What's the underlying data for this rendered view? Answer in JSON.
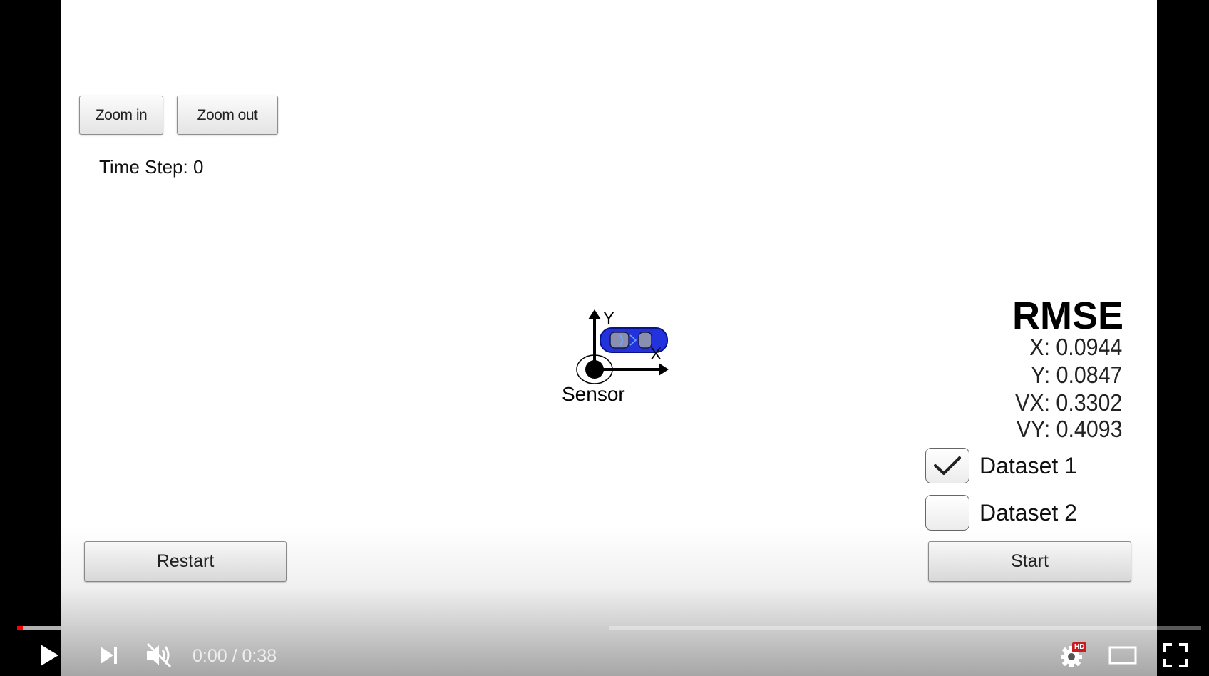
{
  "simulator": {
    "zoom_in_label": "Zoom in",
    "zoom_out_label": "Zoom out",
    "time_step_label": "Time Step:",
    "time_step_value": "0",
    "sensor_label": "Sensor",
    "axis_x_label": "X",
    "axis_y_label": "Y",
    "restart_label": "Restart",
    "start_label": "Start",
    "rmse": {
      "title": "RMSE",
      "x": "X: 0.0944",
      "y": "Y: 0.0847",
      "vx": "VX: 0.3302",
      "vy": "VY: 0.4093"
    },
    "datasets": [
      {
        "label": "Dataset 1",
        "checked": true
      },
      {
        "label": "Dataset 2",
        "checked": false
      }
    ],
    "car_color": "#2233dd"
  },
  "player": {
    "current_time": "0:00",
    "separator": " / ",
    "duration": "0:38",
    "played_fraction": 0.005,
    "loaded_fraction": 0.5,
    "muted": true,
    "hd_badge": "HD",
    "accent_color": "#ff0000",
    "icons": [
      "play-icon",
      "next-icon",
      "volume-muted-icon",
      "settings-icon",
      "theater-mode-icon",
      "fullscreen-icon"
    ]
  }
}
